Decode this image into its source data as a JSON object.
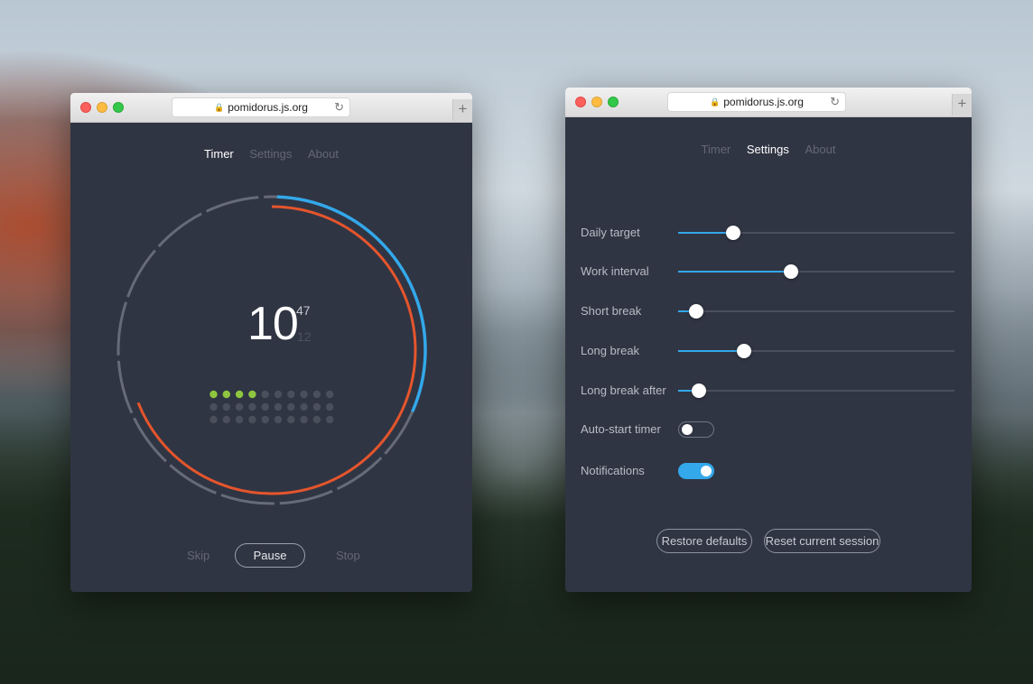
{
  "timer_window": {
    "url": "pomidorus.js.org",
    "nav": [
      {
        "label": "Timer",
        "active": true
      },
      {
        "label": "Settings",
        "active": false
      },
      {
        "label": "About",
        "active": false
      }
    ],
    "time_main": "10",
    "time_seconds": "47",
    "time_secondary": "12",
    "progress": {
      "completed_dots": 4,
      "total_dots": 30,
      "elapsed_fraction": 0.69,
      "blue_fraction": 0.31
    },
    "controls": {
      "skip_label": "Skip",
      "pause_label": "Pause",
      "stop_label": "Stop"
    },
    "colors": {
      "bg": "#303543",
      "accent_orange": "#e5552c",
      "accent_blue": "#33a8ea",
      "accent_green": "#8ec63f",
      "ring_gray": "#666b78"
    }
  },
  "settings_window": {
    "url": "pomidorus.js.org",
    "nav": [
      {
        "label": "Timer",
        "active": false
      },
      {
        "label": "Settings",
        "active": true
      },
      {
        "label": "About",
        "active": false
      }
    ],
    "sliders": [
      {
        "label": "Daily target",
        "value": 0.2
      },
      {
        "label": "Work interval",
        "value": 0.41
      },
      {
        "label": "Short break",
        "value": 0.065
      },
      {
        "label": "Long break",
        "value": 0.24
      },
      {
        "label": "Long break after",
        "value": 0.075
      }
    ],
    "toggles": [
      {
        "label": "Auto-start timer",
        "on": false
      },
      {
        "label": "Notifications",
        "on": true
      }
    ],
    "buttons": {
      "restore_label": "Restore defaults",
      "reset_label": "Reset current session"
    }
  },
  "icons": {
    "lock": "lock-icon",
    "reload": "reload-icon",
    "new_tab": "plus-icon"
  }
}
